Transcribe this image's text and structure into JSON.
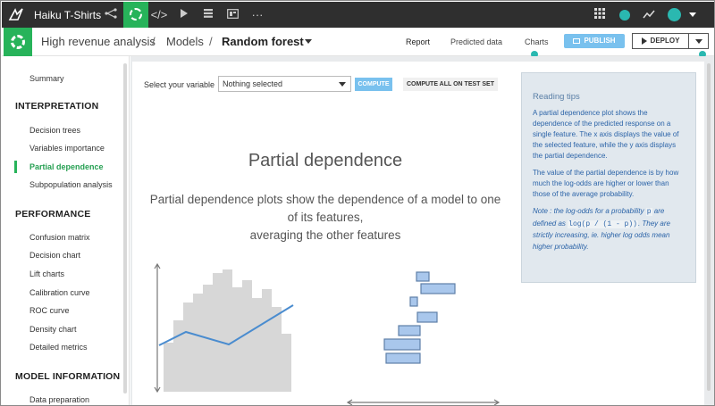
{
  "topbar": {
    "logo": "bird-logo",
    "project_name": "Haiku T-Shirts",
    "icons": [
      "flow-icon",
      "ml-icon",
      "code-icon",
      "run-icon",
      "datasets-icon",
      "dashboard-icon",
      "more-icon",
      "apps-grid-icon",
      "help-icon",
      "activity-icon",
      "user-avatar-icon"
    ],
    "more_label": "···"
  },
  "breadcrumb": {
    "analysis": "High revenue analysis",
    "sep1": "/",
    "models": "Models",
    "sep2": "/",
    "current": "Random forest"
  },
  "tabs": [
    {
      "label": "Report",
      "active": true
    },
    {
      "label": "Predicted data",
      "active": false
    },
    {
      "label": "Charts",
      "active": false
    }
  ],
  "actions": {
    "publish_label": "PUBLISH",
    "deploy_label": "DEPLOY"
  },
  "sidebar": {
    "summary": "Summary",
    "sections": [
      {
        "heading": "INTERPRETATION",
        "items": [
          "Decision trees",
          "Variables importance",
          "Partial dependence",
          "Subpopulation analysis"
        ]
      },
      {
        "heading": "PERFORMANCE",
        "items": [
          "Confusion matrix",
          "Decision chart",
          "Lift charts",
          "Calibration curve",
          "ROC curve",
          "Density chart",
          "Detailed metrics"
        ]
      },
      {
        "heading": "MODEL INFORMATION",
        "items": [
          "Data preparation"
        ]
      }
    ],
    "active_item": "Partial dependence"
  },
  "controls": {
    "variable_label": "Select your variable",
    "variable_value": "Nothing selected",
    "compute_label": "COMPUTE",
    "compute_all_label": "COMPUTE ALL ON TEST SET"
  },
  "content": {
    "title": "Partial dependence",
    "description_line1": "Partial dependence plots show the dependence of a model to one",
    "description_line2": "of its features,",
    "description_line3": "averaging the other features"
  },
  "tips": {
    "title": "Reading tips",
    "para1": "A partial dependence plot shows the dependence of the predicted response on a single feature. The x axis displays the value of the selected feature, while the y axis displays the partial dependence.",
    "para2": "The value of the partial dependence is by how much the log-odds are higher or lower than those of the average probability.",
    "note_a": "Note : the log-odds for a probability ",
    "note_code1": "p",
    "note_b": " are defined as ",
    "note_code2": "log(p / (1 - p))",
    "note_c": ". They are strictly increasing, ie. higher log odds mean higher probability."
  },
  "colors": {
    "brand_green": "#27b35a",
    "accent_teal": "#2ab8b0",
    "button_blue": "#79c1ee",
    "tips_text": "#2c64a8",
    "topbar_bg": "#2f2f2f"
  }
}
